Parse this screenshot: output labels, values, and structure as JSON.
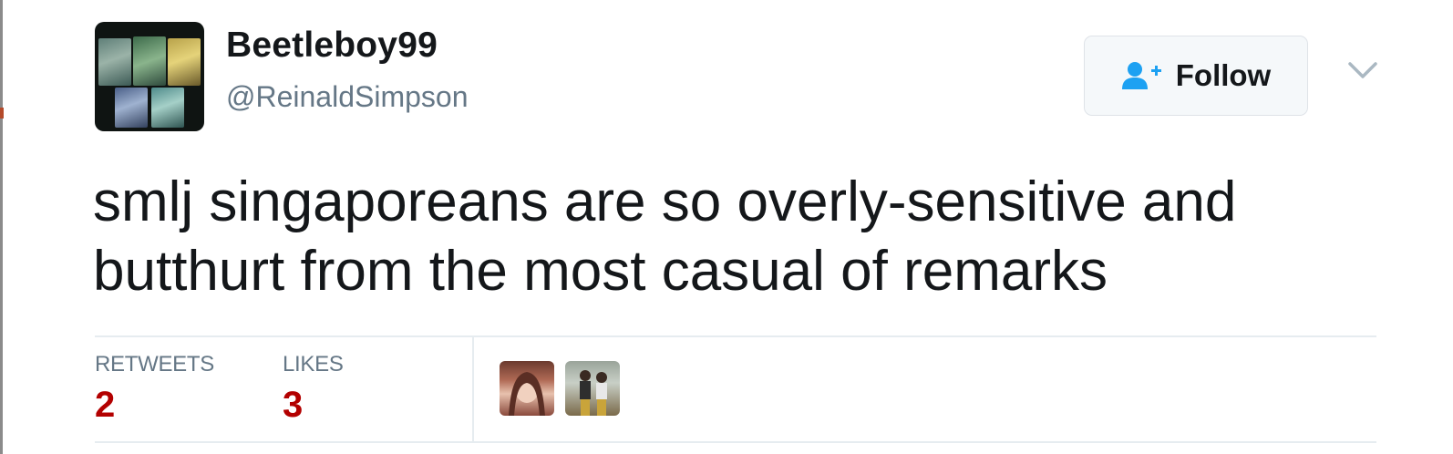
{
  "user": {
    "display_name": "Beetleboy99",
    "screen_name": "@ReinaldSimpson",
    "avatar_icon": "avatar-trading-cards"
  },
  "header": {
    "follow_label": "Follow",
    "follow_icon": "add-user-icon",
    "menu_icon": "chevron-down-icon"
  },
  "tweet": {
    "line1": "smlj singaporeans are so overly-sensitive and",
    "line2": "butthurt from the most casual of remarks"
  },
  "stats": {
    "retweets_label": "RETWEETS",
    "retweets_value": "2",
    "likes_label": "LIKES",
    "likes_value": "3"
  },
  "likers": [
    {
      "icon": "liker-avatar-1"
    },
    {
      "icon": "liker-avatar-2"
    }
  ],
  "colors": {
    "accent": "#1da1f2",
    "stat_value": "#b30000",
    "muted": "#657786",
    "text": "#14171a"
  }
}
